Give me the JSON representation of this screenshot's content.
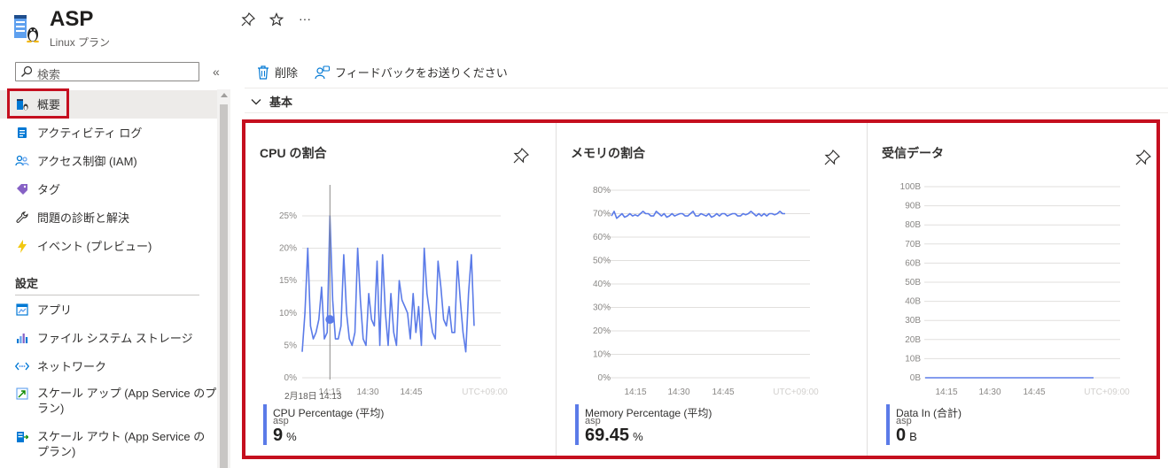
{
  "header": {
    "title": "ASP",
    "subtitle": "Linux プラン",
    "icons": [
      "app-service-plan-icon",
      "pin-icon",
      "star-icon",
      "more-icon"
    ],
    "more_label": "···"
  },
  "sidebar": {
    "search_placeholder": "検索",
    "collapse_label": "«",
    "items": [
      {
        "label": "概要",
        "icon": "overview-icon",
        "selected": true
      },
      {
        "label": "アクティビティ ログ",
        "icon": "activity-log-icon"
      },
      {
        "label": "アクセス制御 (IAM)",
        "icon": "iam-icon"
      },
      {
        "label": "タグ",
        "icon": "tag-icon"
      },
      {
        "label": "問題の診断と解決",
        "icon": "wrench-icon"
      },
      {
        "label": "イベント (プレビュー)",
        "icon": "lightning-icon"
      }
    ],
    "section_settings": "設定",
    "settings_items": [
      {
        "label": "アプリ",
        "icon": "app-icon"
      },
      {
        "label": "ファイル システム ストレージ",
        "icon": "storage-chart-icon"
      },
      {
        "label": "ネットワーク",
        "icon": "network-icon"
      },
      {
        "label": "スケール アップ (App Service のプラン)",
        "line1": "スケール アップ (App Service のプ",
        "line2": "ラン)",
        "icon": "scale-up-icon"
      },
      {
        "label": "スケール アウト (App Service の プラン)",
        "line1": "スケール アウト (App Service の",
        "line2": "プラン)",
        "icon": "scale-out-icon"
      }
    ]
  },
  "toolbar": {
    "delete_label": "削除",
    "feedback_label": "フィードバックをお送りください"
  },
  "essentials_label": "基本",
  "colors": {
    "accent": "#0078d4",
    "series": "#5b7be8",
    "highlight": "#c50f1f"
  },
  "tiles": [
    {
      "title": "CPU の割合",
      "legend": {
        "name": "CPU Percentage (平均)",
        "resource": "asp",
        "value": "9",
        "unit": "%"
      },
      "tooltip_time": "2月18日 14:13"
    },
    {
      "title": "メモリの割合",
      "legend": {
        "name": "Memory Percentage (平均)",
        "resource": "asp",
        "value": "69.45",
        "unit": "%"
      }
    },
    {
      "title": "受信データ",
      "legend": {
        "name": "Data In (合計)",
        "resource": "asp",
        "value": "0",
        "unit": "B"
      }
    }
  ],
  "chart_data": [
    {
      "type": "line",
      "title": "CPU の割合",
      "x_ticks": [
        "14:15",
        "14:30",
        "14:45"
      ],
      "timezone_label": "UTC+09:00",
      "y_ticks": [
        "0%",
        "5%",
        "10%",
        "15%",
        "20%",
        "25%"
      ],
      "ylim": [
        0,
        25
      ],
      "series": [
        {
          "name": "CPU Percentage (平均)",
          "values": [
            4,
            10,
            20,
            8,
            6,
            7,
            9,
            14,
            6,
            7,
            25,
            12,
            6,
            6,
            8,
            19,
            10,
            6,
            5,
            7,
            20,
            12,
            6,
            5,
            13,
            9,
            8,
            18,
            5,
            19,
            10,
            5,
            13,
            7,
            5,
            15,
            12,
            11,
            10,
            6,
            13,
            7,
            11,
            5,
            20,
            13,
            10,
            7,
            6,
            18,
            14,
            9,
            8,
            11,
            7,
            7,
            18,
            12,
            7,
            4,
            13,
            19,
            8
          ]
        }
      ],
      "marker": {
        "x_index": 10,
        "value": 9
      }
    },
    {
      "type": "line",
      "title": "メモリの割合",
      "x_ticks": [
        "14:15",
        "14:30",
        "14:45"
      ],
      "timezone_label": "UTC+09:00",
      "y_ticks": [
        "0%",
        "10%",
        "20%",
        "30%",
        "40%",
        "50%",
        "60%",
        "70%",
        "80%"
      ],
      "ylim": [
        0,
        80
      ],
      "series": [
        {
          "name": "Memory Percentage (平均)",
          "values": [
            69,
            71,
            68,
            69,
            70,
            68.5,
            69,
            70,
            69,
            69.5,
            69,
            70,
            71,
            70,
            70,
            69,
            69,
            71,
            70,
            69,
            70,
            68.5,
            69,
            70,
            69,
            69.5,
            70,
            70,
            69,
            69,
            70,
            71,
            69,
            69,
            70,
            69.5,
            69,
            70,
            68.5,
            69,
            70,
            69,
            70,
            70,
            69,
            69.5,
            70,
            70,
            69,
            69,
            70,
            69.5,
            70,
            71,
            70,
            69,
            70,
            69,
            70,
            69,
            70,
            70,
            69.5,
            70,
            71,
            70,
            70
          ]
        }
      ]
    },
    {
      "type": "line",
      "title": "受信データ",
      "x_ticks": [
        "14:15",
        "14:30",
        "14:45"
      ],
      "timezone_label": "UTC+09:00",
      "y_ticks": [
        "0B",
        "10B",
        "20B",
        "30B",
        "40B",
        "50B",
        "60B",
        "70B",
        "80B",
        "90B",
        "100B"
      ],
      "ylim": [
        0,
        100
      ],
      "series": [
        {
          "name": "Data In (合計)",
          "values": [
            0,
            0,
            0,
            0,
            0,
            0,
            0,
            0,
            0,
            0,
            0,
            0,
            0,
            0,
            0,
            0,
            0,
            0,
            0,
            0,
            0,
            0,
            0,
            0,
            0,
            0,
            0,
            0,
            0,
            0,
            0,
            0,
            0,
            0,
            0,
            0,
            0,
            0,
            0,
            0,
            0,
            0,
            0,
            0,
            0,
            0,
            0,
            0,
            0,
            0,
            0,
            0,
            0,
            0,
            0,
            0,
            0,
            0,
            0,
            0,
            0,
            0,
            0,
            0
          ]
        }
      ]
    }
  ]
}
